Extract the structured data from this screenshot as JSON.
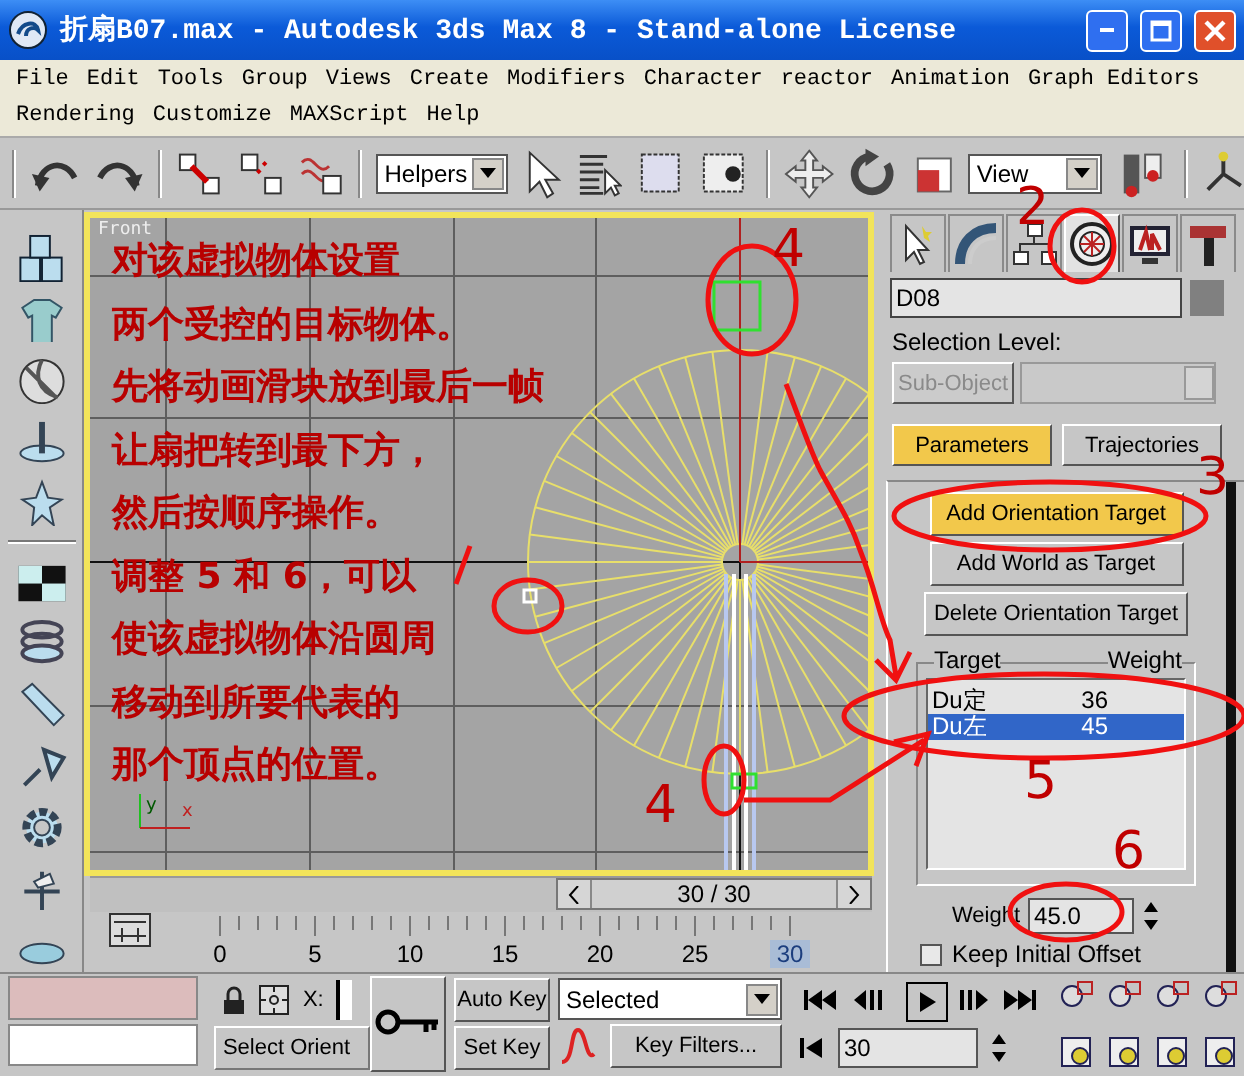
{
  "window": {
    "title": "折扇B07.max - Autodesk 3ds Max 8  - Stand-alone License"
  },
  "menu_rows": [
    [
      "File",
      "Edit",
      "Tools",
      "Group",
      "Views",
      "Create",
      "Modifiers",
      "Character",
      "reactor",
      "Animation",
      "Graph Editors"
    ],
    [
      "Rendering",
      "Customize",
      "MAXScript",
      "Help"
    ]
  ],
  "toolbar": {
    "selection_filter": "Helpers",
    "reference_coordinate_system": "View"
  },
  "viewport": {
    "label": "Front",
    "active": true,
    "axis_labels": [
      "y",
      "x"
    ],
    "notes": [
      "对该虚拟物体设置",
      "两个受控的目标物体。",
      "先将动画滑块放到最后一帧",
      "让扇把转到最下方，",
      "然后按顺序操作。",
      "调整 5 和 6，可以",
      "使该虚拟物体沿圆周",
      "移动到所要代表的",
      "那个顶点的位置。"
    ]
  },
  "time_slider": {
    "reading": "30 / 30",
    "level": 1
  },
  "trackbar": {
    "labels": [
      {
        "text": "0",
        "selected": false
      },
      {
        "text": "5",
        "selected": false
      },
      {
        "text": "10",
        "selected": false
      },
      {
        "text": "15",
        "selected": false
      },
      {
        "text": "20",
        "selected": false
      },
      {
        "text": "25",
        "selected": false
      },
      {
        "text": "30",
        "selected": true
      }
    ]
  },
  "command_panel": {
    "tabs": [
      {
        "kind": "create",
        "selected": false
      },
      {
        "kind": "modify",
        "selected": false
      },
      {
        "kind": "hierarchy",
        "selected": false
      },
      {
        "kind": "motion",
        "selected": true
      },
      {
        "kind": "display",
        "selected": false
      },
      {
        "kind": "utilities",
        "selected": false
      }
    ],
    "object_name": "D08",
    "selection_level_label": "Selection Level:",
    "sub_object": {
      "label": "Sub-Object",
      "disabled": true
    },
    "rollout_tabs": [
      {
        "label": "Parameters",
        "selected": true
      },
      {
        "label": "Trajectories",
        "selected": false
      }
    ],
    "buttons": [
      {
        "label": "Add Orientation Target",
        "active": true
      },
      {
        "label": "Add World as Target",
        "active": false
      },
      {
        "label": "Delete Orientation Target",
        "active": false
      }
    ],
    "target_list": {
      "columns": [
        "Target",
        "Weight"
      ],
      "rows": [
        {
          "target": "Du定",
          "weight": "36",
          "selected": false
        },
        {
          "target": "Du左",
          "weight": "45",
          "selected": true
        }
      ]
    },
    "weight_label": "Weight",
    "weight_value": "45.0",
    "keep_initial_offset": {
      "label": "Keep Initial Offset",
      "checked": false
    }
  },
  "status": {
    "coord_label": "X:",
    "prompt": "Select Orient",
    "auto_key": "Auto Key",
    "set_key": "Set Key",
    "key_set": "Selected",
    "key_filters": "Key Filters...",
    "current_frame": "30"
  },
  "annotations": [
    {
      "text": "2"
    },
    {
      "text": "3"
    },
    {
      "text": "4"
    },
    {
      "text": "4"
    },
    {
      "text": "5"
    },
    {
      "text": "6"
    }
  ]
}
